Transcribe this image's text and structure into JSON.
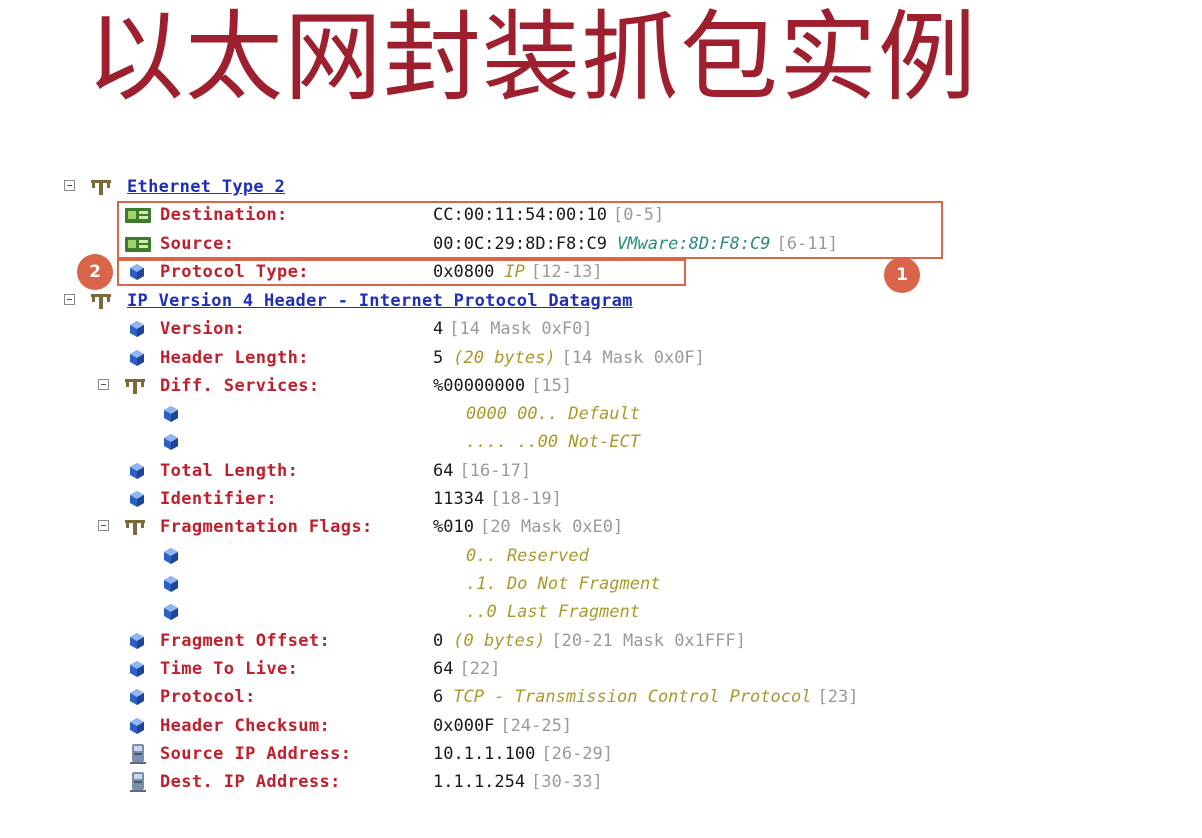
{
  "slide": {
    "title": "以太网封装抓包实例"
  },
  "annotations": {
    "badge_1": "1",
    "badge_2": "2"
  },
  "ethernet": {
    "header": "Ethernet Type 2",
    "destination": {
      "label": "Destination:",
      "value": "CC:00:11:54:00:10",
      "range": "[0-5]"
    },
    "source": {
      "label": "Source:",
      "value": "00:0C:29:8D:F8:C9",
      "desc": "VMware:8D:F8:C9",
      "range": "[6-11]"
    },
    "protocol_type": {
      "label": "Protocol Type:",
      "value": "0x0800",
      "desc": "IP",
      "range": "[12-13]"
    }
  },
  "ip": {
    "header": "IP Version 4 Header - Internet Protocol Datagram",
    "version": {
      "label": "Version:",
      "value": "4",
      "range": "[14 Mask 0xF0]"
    },
    "header_length": {
      "label": "Header Length:",
      "value": "5",
      "desc": "(20 bytes)",
      "range": "[14 Mask 0x0F]"
    },
    "diff_services": {
      "label": "Diff. Services:",
      "value": "%00000000",
      "range": "[15]",
      "bits": [
        "0000 00.. Default",
        ".... ..00 Not-ECT"
      ]
    },
    "total_length": {
      "label": "Total Length:",
      "value": "64",
      "range": "[16-17]"
    },
    "identifier": {
      "label": "Identifier:",
      "value": "11334",
      "range": "[18-19]"
    },
    "frag_flags": {
      "label": "Fragmentation Flags:",
      "value": "%010",
      "range": "[20 Mask 0xE0]",
      "bits": [
        "0.. Reserved",
        ".1. Do Not Fragment",
        "..0 Last Fragment"
      ]
    },
    "fragment_offset": {
      "label": "Fragment Offset:",
      "value": "0",
      "desc": "(0 bytes)",
      "range": "[20-21 Mask 0x1FFF]"
    },
    "ttl": {
      "label": "Time To Live:",
      "value": "64",
      "range": "[22]"
    },
    "protocol": {
      "label": "Protocol:",
      "value": "6",
      "desc": "TCP - Transmission Control Protocol",
      "range": "[23]"
    },
    "checksum": {
      "label": "Header Checksum:",
      "value": "0x000F",
      "range": "[24-25]"
    },
    "src_ip": {
      "label": "Source IP Address:",
      "value": "10.1.1.100",
      "range": "[26-29]"
    },
    "dst_ip": {
      "label": "Dest. IP Address:",
      "value": "1.1.1.254",
      "range": "[30-33]"
    }
  }
}
